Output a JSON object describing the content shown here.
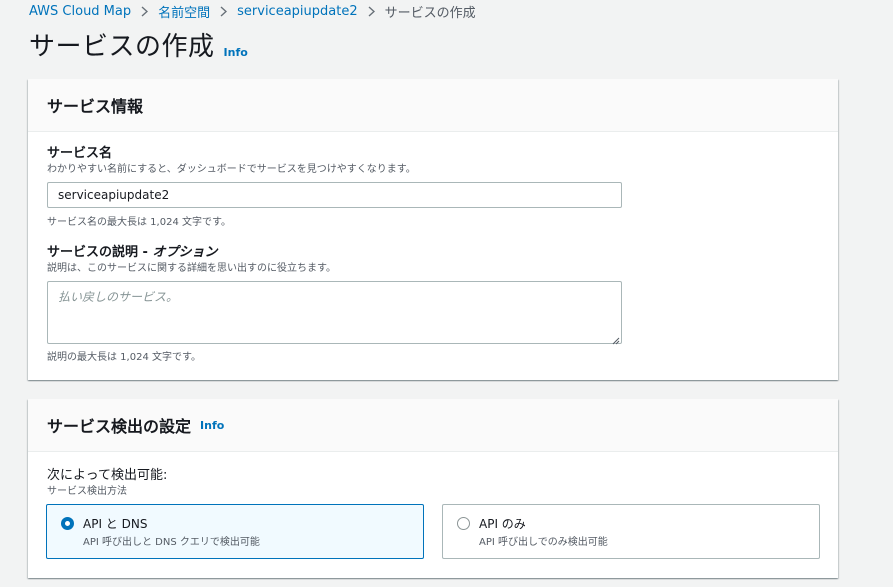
{
  "breadcrumb": {
    "items": [
      "AWS Cloud Map",
      "名前空間",
      "serviceapiupdate2"
    ],
    "current": "サービスの作成"
  },
  "page": {
    "title": "サービスの作成",
    "info_label": "Info"
  },
  "service_info": {
    "header": "サービス情報",
    "name": {
      "label": "サービス名",
      "description": "わかりやすい名前にすると、ダッシュボードでサービスを見つけやすくなります。",
      "value": "serviceapiupdate2",
      "constraint": "サービス名の最大長は 1,024 文字です。"
    },
    "description": {
      "label": "サービスの説明 - ",
      "label_optional": "オプション",
      "description": "説明は、このサービスに関する詳細を思い出すのに役立ちます。",
      "placeholder": "払い戻しのサービス。",
      "constraint": "説明の最大長は 1,024 文字です。"
    }
  },
  "discovery": {
    "header": "サービス検出の設定",
    "info_label": "Info",
    "label": "次によって検出可能:",
    "description": "サービス検出方法",
    "options": [
      {
        "title": "API と DNS",
        "description": "API 呼び出しと DNS クエリで検出可能",
        "selected": true
      },
      {
        "title": "API のみ",
        "description": "API 呼び出しでのみ検出可能",
        "selected": false
      }
    ]
  },
  "colors": {
    "link": "#0073bb",
    "background": "#f2f3f3",
    "selected_tile": "#f1faff"
  }
}
